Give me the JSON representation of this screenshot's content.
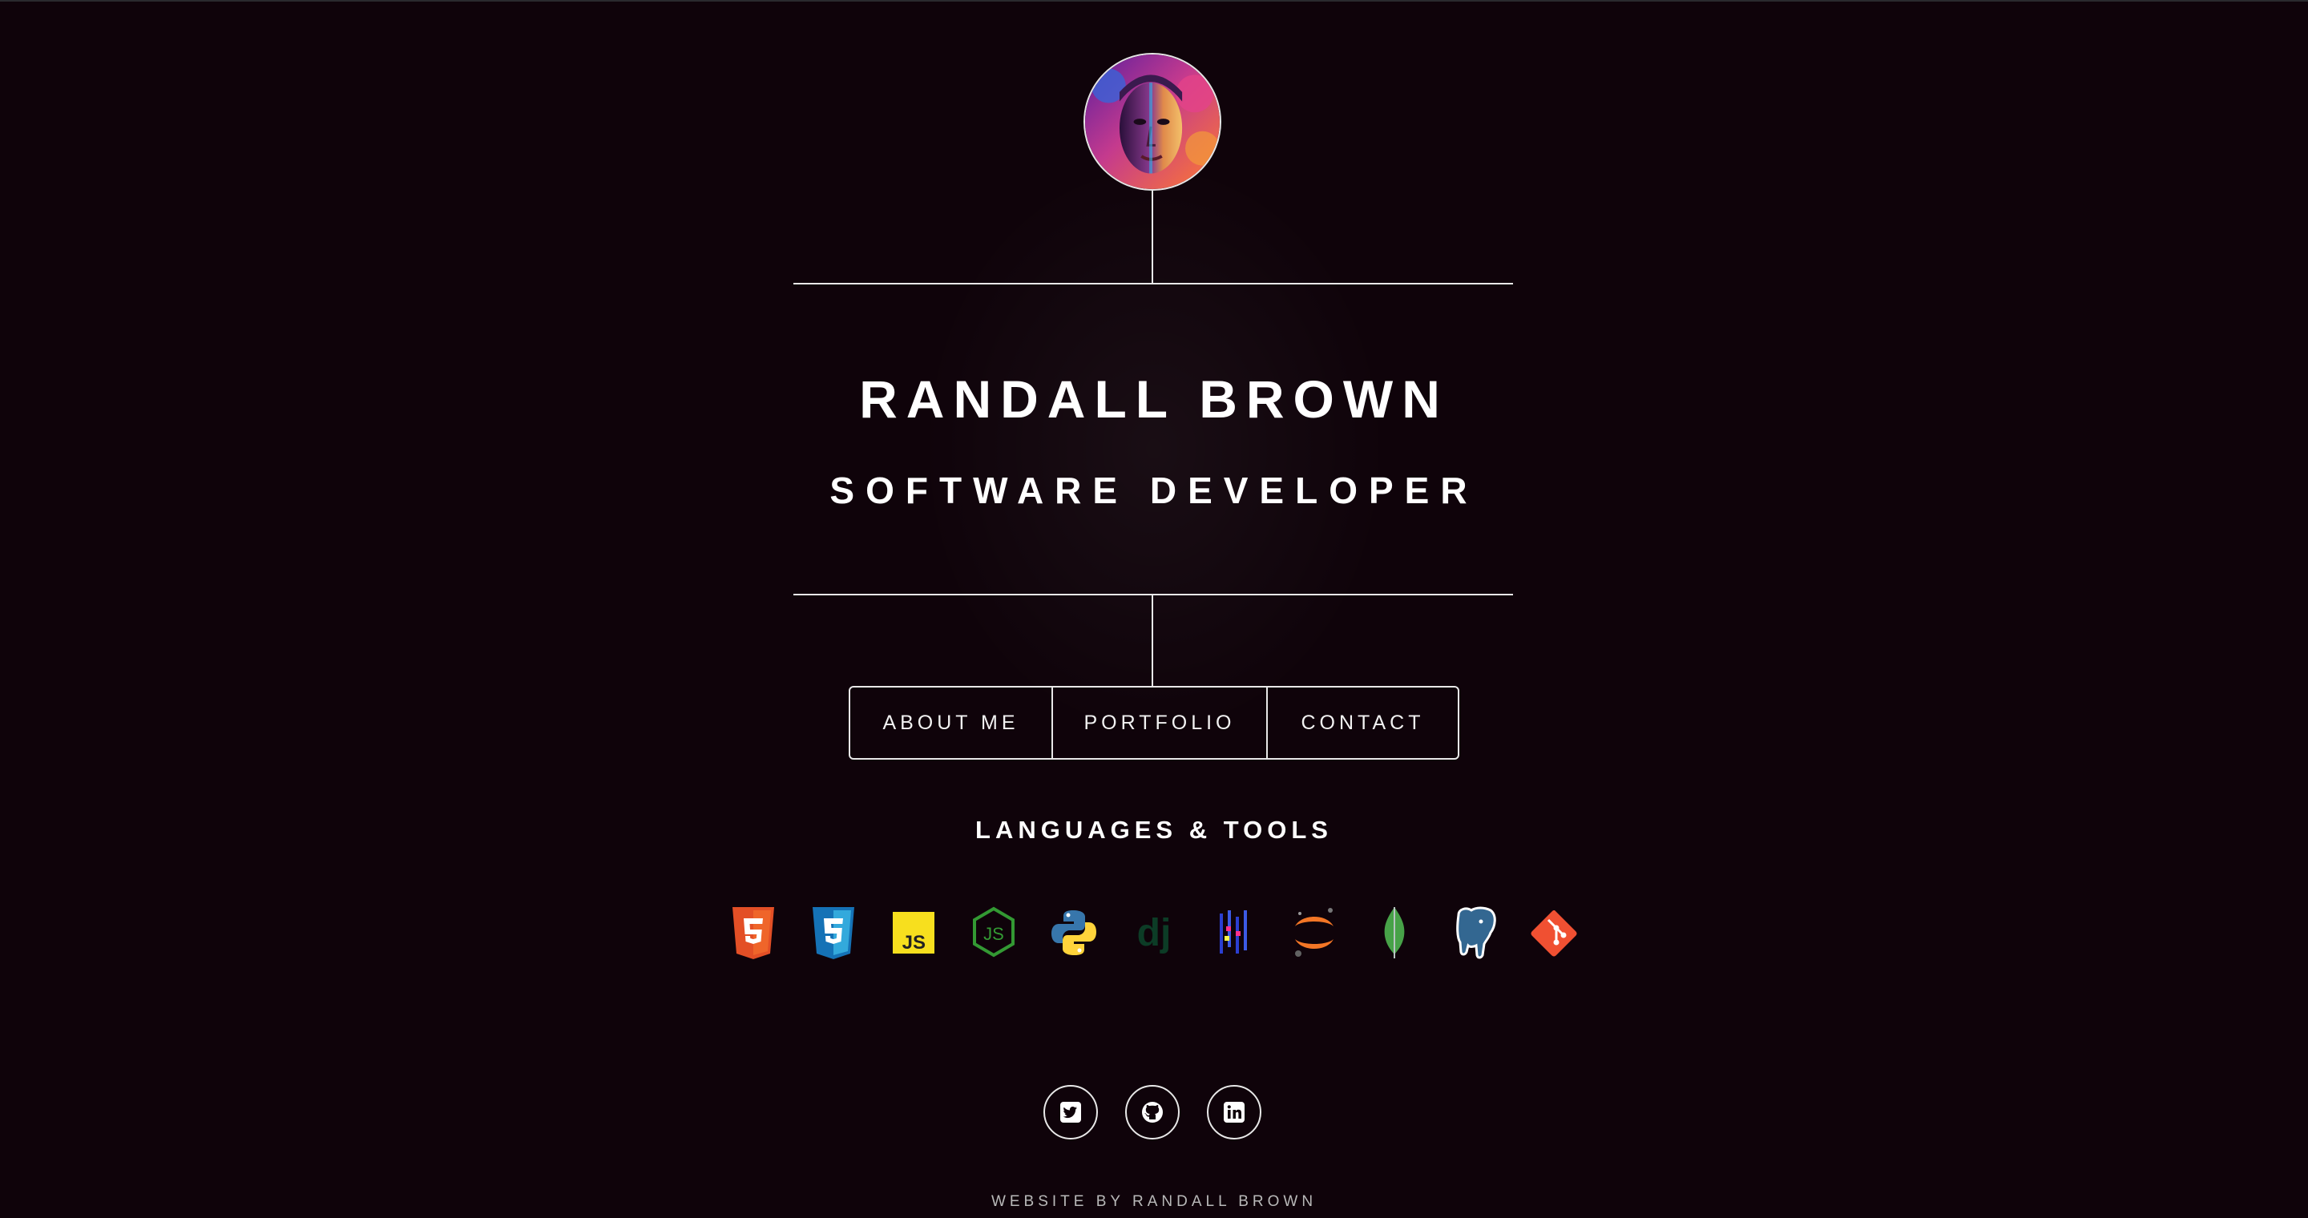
{
  "profile": {
    "name": "RANDALL BROWN",
    "role": "SOFTWARE DEVELOPER",
    "avatar_icon": "portrait-avatar"
  },
  "nav": {
    "about_label": "ABOUT ME",
    "portfolio_label": "PORTFOLIO",
    "contact_label": "CONTACT"
  },
  "tools": {
    "title": "LANGUAGES & TOOLS",
    "icons": [
      "html5-icon",
      "css3-icon",
      "javascript-icon",
      "nodejs-icon",
      "python-icon",
      "django-icon",
      "pycharm-icon",
      "jupyter-icon",
      "mongodb-icon",
      "postgresql-icon",
      "git-icon"
    ]
  },
  "social": {
    "icons": [
      "twitter-icon",
      "github-icon",
      "linkedin-icon"
    ]
  },
  "footer": {
    "credit": "WEBSITE BY RANDALL BROWN"
  },
  "colors": {
    "background": "#0f030a",
    "line": "#e8e8e8",
    "html5": "#e34f26",
    "css3": "#1572b6",
    "javascript": "#f7df1e",
    "nodejs": "#339933",
    "python_blue": "#3776ab",
    "python_yellow": "#ffd43b",
    "django": "#0c3c26",
    "jupyter": "#f37626",
    "mongodb": "#47a248",
    "postgresql": "#336791",
    "git": "#f05032"
  }
}
